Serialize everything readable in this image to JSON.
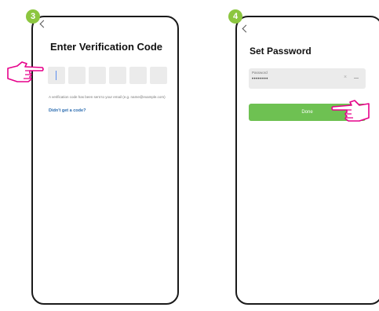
{
  "steps": [
    {
      "number": "3",
      "title": "Enter Verification Code",
      "code_slots": 6,
      "hint": "A verification code has been sent to your email (e.g. name@example.com)",
      "resend_link": "Didn't get a code?"
    },
    {
      "number": "4",
      "title": "Set Password",
      "password_label": "Password",
      "password_value": "••••••••",
      "done_label": "Done"
    }
  ],
  "colors": {
    "badge": "#8cc63f",
    "button": "#6ec152",
    "link": "#2b6cb0",
    "field": "#ebebeb"
  },
  "icons": [
    "back-chevron-icon",
    "pointing-hand-icon",
    "clear-icon",
    "eye-icon"
  ]
}
